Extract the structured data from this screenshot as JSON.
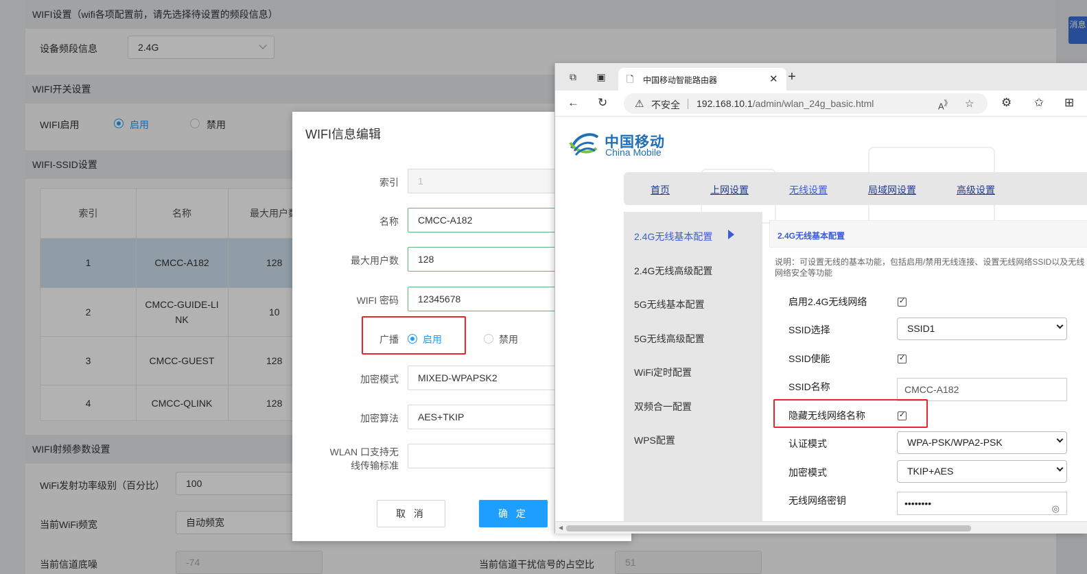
{
  "bg": {
    "section1_title": "WIFI设置（wifi各项配置前，请先选择待设置的频段信息）",
    "band_label": "设备频段信息",
    "band_value": "2.4G",
    "section2_title": "WIFI开关设置",
    "wifi_enable_label": "WIFI启用",
    "enable": "启用",
    "disable": "禁用",
    "section3_title": "WIFI-SSID设置",
    "table": {
      "headers": [
        "索引",
        "名称",
        "最大用户数"
      ],
      "rows": [
        [
          "1",
          "CMCC-A182",
          "128"
        ],
        [
          "2",
          "CMCC-GUIDE-LINK",
          "10"
        ],
        [
          "3",
          "CMCC-GUEST",
          "128"
        ],
        [
          "4",
          "CMCC-QLINK",
          "128"
        ]
      ]
    },
    "section4_title": "WIFI射频参数设置",
    "power_label": "WiFi发射功率级别（百分比）",
    "power_value": "100",
    "bandwidth_label": "当前WiFi频宽",
    "bandwidth_value": "自动频宽",
    "noise_label": "当前信道底噪",
    "noise_value": "-74",
    "interference_label": "当前信道干扰信号的占空比",
    "interference_value": "51",
    "side_tab_text": "消息"
  },
  "modal": {
    "title": "WIFI信息编辑",
    "index_label": "索引",
    "index_value": "1",
    "name_label": "名称",
    "name_value": "CMCC-A182",
    "max_users_label": "最大用户数",
    "max_users_value": "128",
    "password_label": "WIFI 密码",
    "password_value": "12345678",
    "broadcast_label": "广播",
    "broadcast_on": "启用",
    "broadcast_off": "禁用",
    "encrypt_mode_label": "加密模式",
    "encrypt_mode_value": "MIXED-WPAPSK2",
    "encrypt_algo_label": "加密算法",
    "encrypt_algo_value": "AES+TKIP",
    "wlan_std_label_1": "WLAN 口支持无",
    "wlan_std_label_2": "线传输标准",
    "wlan_std_value": "",
    "cancel": "取 消",
    "confirm": "确 定",
    "accent_color": "#1e9fff",
    "highlight_color": "#e8262a"
  },
  "browser": {
    "tab_title": "中国移动智能路由器",
    "insecure_text": "不安全",
    "url_host": "192.168.10.1",
    "url_path": "/admin/wlan_24g_basic.html",
    "logo_cn": "中国移动",
    "logo_en": "China Mobile",
    "nav": [
      "首页",
      "上网设置",
      "无线设置",
      "局域网设置",
      "高级设置"
    ],
    "sidebar": [
      "2.4G无线基本配置",
      "2.4G无线高级配置",
      "5G无线基本配置",
      "5G无线高级配置",
      "WiFi定时配置",
      "双频合一配置",
      "WPS配置"
    ],
    "config_title": "2.4G无线基本配置",
    "config_note": "说明：可设置无线的基本功能，包括启用/禁用无线连接、设置无线网络SSID以及无线网络安全等功能",
    "fields": {
      "enable_24g": "启用2.4G无线网络",
      "ssid_select": "SSID选择",
      "ssid_select_value": "SSID1",
      "ssid_enable": "SSID使能",
      "ssid_name": "SSID名称",
      "ssid_name_value": "CMCC-A182",
      "hide_ssid": "隐藏无线网络名称",
      "auth_mode": "认证模式",
      "auth_mode_value": "WPA-PSK/WPA2-PSK",
      "encrypt_mode": "加密模式",
      "encrypt_mode_value": "TKIP+AES",
      "wireless_key": "无线网络密钥",
      "wireless_key_value": "••••••••"
    },
    "brand_color": "#1f6fb7",
    "active_color": "#3b5bdb"
  }
}
